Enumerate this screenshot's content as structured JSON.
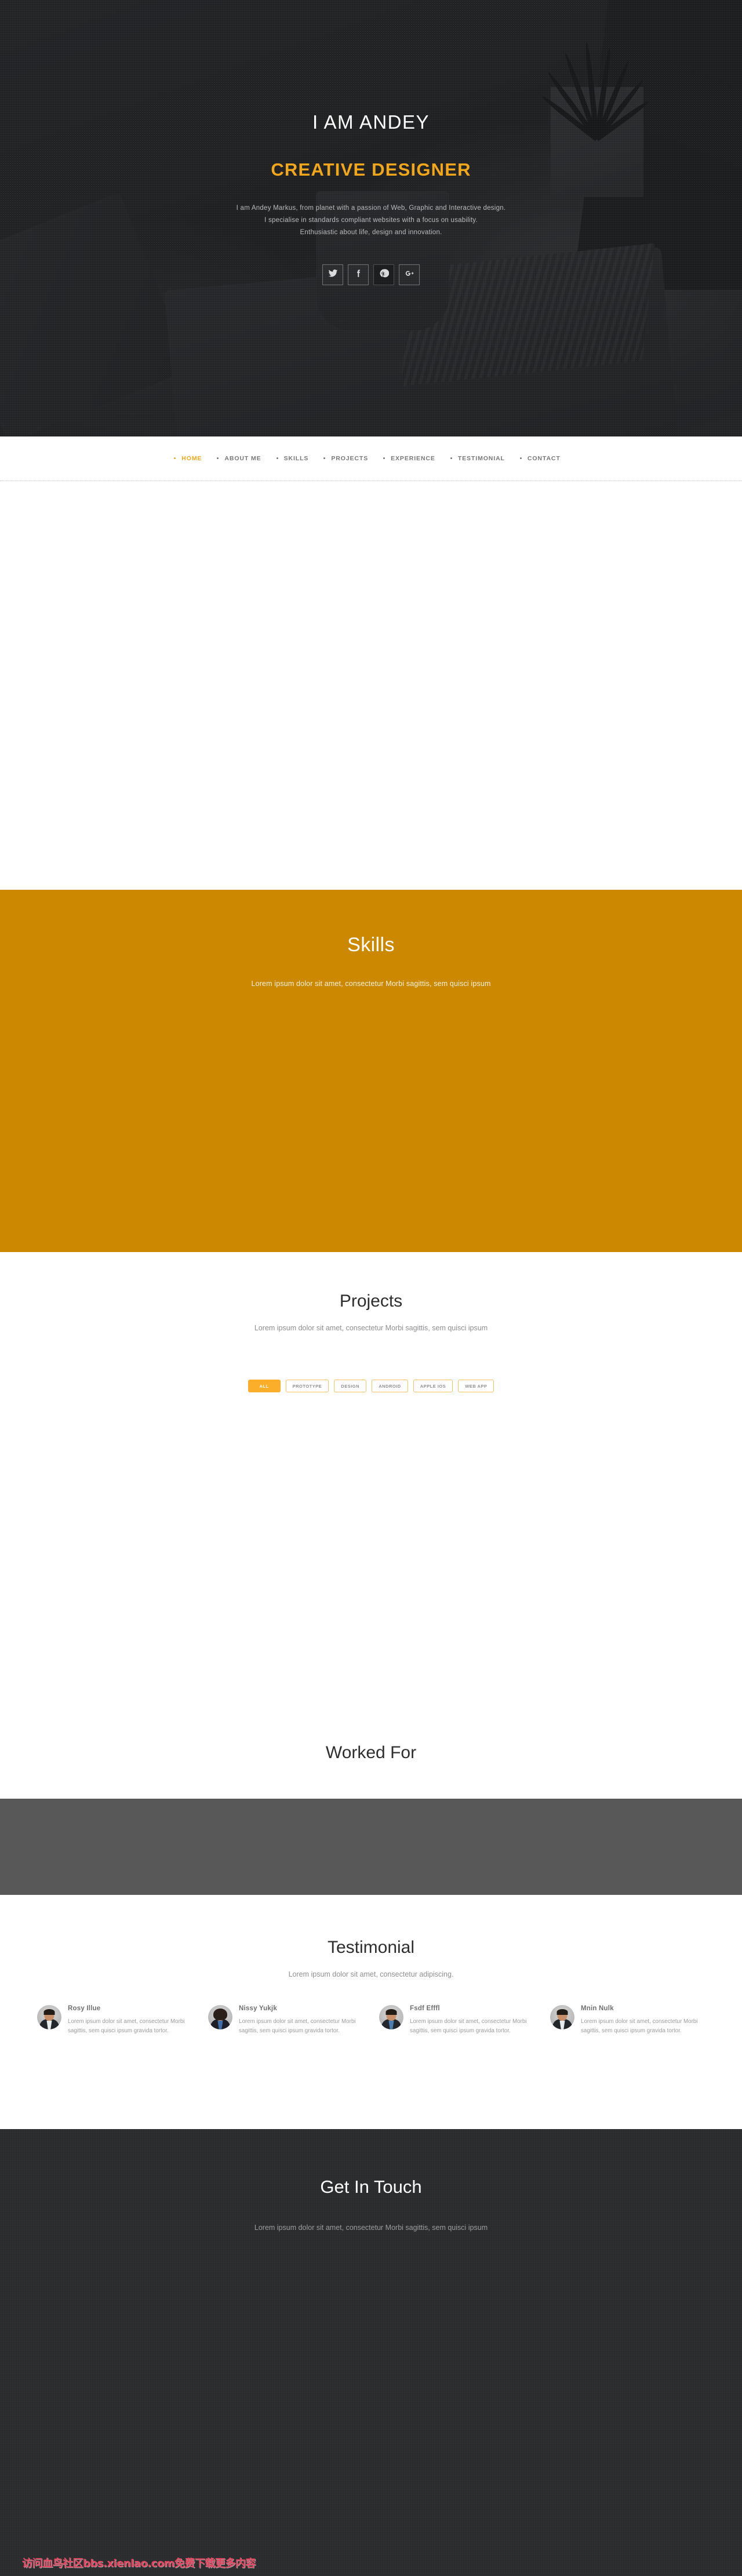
{
  "hero": {
    "name": "I AM ANDEY",
    "role": "CREATIVE DESIGNER",
    "desc_line1": "I am Andey Markus, from planet with a passion of Web, Graphic and Interactive design.",
    "desc_line2": "I specialise in standards compliant websites with a focus on usability.",
    "desc_line3": "Enthusiastic about life, design and innovation.",
    "accent_color": "#f2a61a",
    "social": [
      {
        "name": "twitter-icon",
        "label": "Twitter"
      },
      {
        "name": "facebook-icon",
        "label": "Facebook"
      },
      {
        "name": "pinterest-icon",
        "label": "Pinterest"
      },
      {
        "name": "google-plus-icon",
        "label": "Google Plus"
      }
    ]
  },
  "nav": {
    "items": [
      {
        "label": "HOME",
        "active": true
      },
      {
        "label": "ABOUT ME",
        "active": false
      },
      {
        "label": "SKILLS",
        "active": false
      },
      {
        "label": "PROJECTS",
        "active": false
      },
      {
        "label": "EXPERIENCE",
        "active": false
      },
      {
        "label": "TESTIMONIAL",
        "active": false
      },
      {
        "label": "CONTACT",
        "active": false
      }
    ]
  },
  "skills": {
    "title": "Skills",
    "subtitle": "Lorem ipsum dolor sit amet, consectetur Morbi sagittis, sem quisci ipsum",
    "background_color": "#cc8800"
  },
  "projects": {
    "title": "Projects",
    "subtitle": "Lorem ipsum dolor sit amet, consectetur Morbi sagittis, sem quisci ipsum",
    "filters": [
      {
        "label": "ALL",
        "active": true
      },
      {
        "label": "PROTOTYPE",
        "active": false
      },
      {
        "label": "DESIGN",
        "active": false
      },
      {
        "label": "ANDROID",
        "active": false
      },
      {
        "label": "APPLE IOS",
        "active": false
      },
      {
        "label": "WEB APP",
        "active": false
      }
    ],
    "active_color": "#fbae2a"
  },
  "worked": {
    "title": "Worked For",
    "band_color": "#585858"
  },
  "testimonial": {
    "title": "Testimonial",
    "subtitle": "Lorem ipsum dolor sit amet, consectetur adipiscing.",
    "items": [
      {
        "name": "Rosy Illue",
        "text": "Lorem ipsum dolor sit amet, consectetur Morbi sagittis, sem quisci ipsum gravida tortor."
      },
      {
        "name": "Nissy Yukjk",
        "text": "Lorem ipsum dolor sit amet, consectetur Morbi sagittis, sem quisci ipsum gravida tortor."
      },
      {
        "name": "Fsdf Efffl",
        "text": "Lorem ipsum dolor sit amet, consectetur Morbi sagittis, sem quisci ipsum gravida tortor."
      },
      {
        "name": "Mnin Nulk",
        "text": "Lorem ipsum dolor sit amet, consectetur Morbi sagittis, sem quisci ipsum gravida tortor."
      }
    ]
  },
  "contact": {
    "title": "Get In Touch",
    "subtitle": "Lorem ipsum dolor sit amet, consectetur Morbi sagittis, sem quisci ipsum"
  },
  "watermark": {
    "text": "访问血鸟社区bbs.xienlao.com免费下载更多内容"
  }
}
